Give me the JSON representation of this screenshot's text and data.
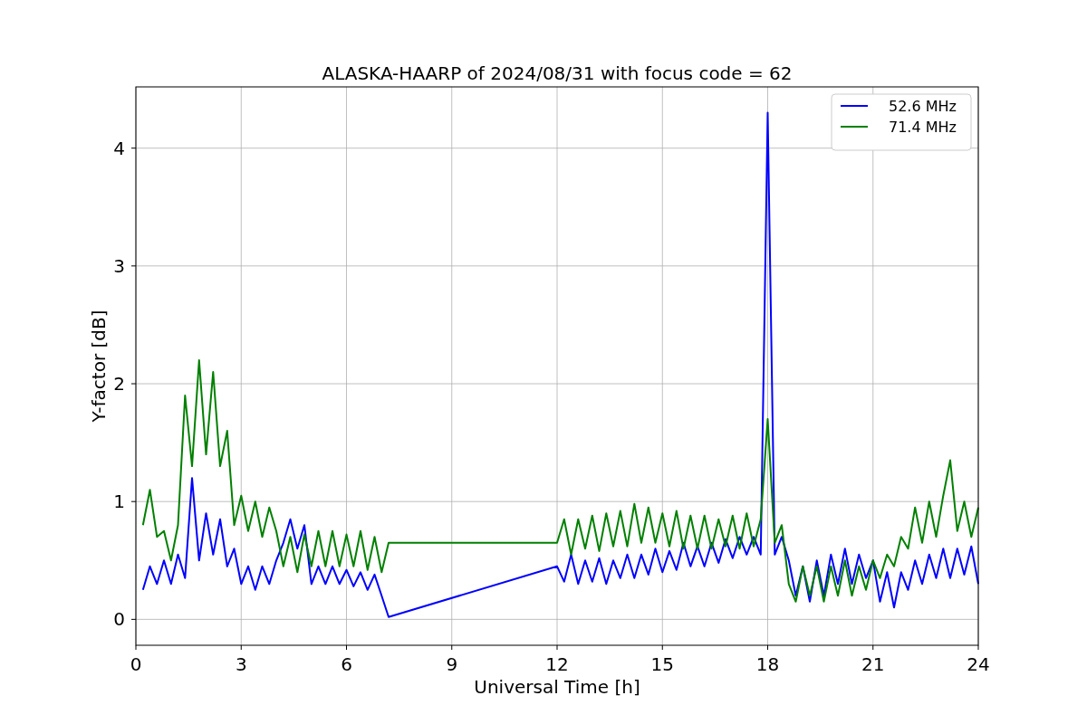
{
  "figure": {
    "chart_data": {
      "type": "line",
      "title": "ALASKA-HAARP of 2024/08/31 with focus code = 62",
      "xlabel": "Universal Time [h]",
      "ylabel": "Y-factor [dB]",
      "xlim": [
        0,
        24
      ],
      "ylim": [
        -0.22,
        4.52
      ],
      "xticks": [
        0,
        3,
        6,
        9,
        12,
        15,
        18,
        21,
        24
      ],
      "yticks": [
        0,
        1,
        2,
        3,
        4
      ],
      "grid": true,
      "legend": true,
      "x": [
        0.2,
        0.4,
        0.6,
        0.8,
        1.0,
        1.2,
        1.4,
        1.6,
        1.8,
        2.0,
        2.2,
        2.4,
        2.6,
        2.8,
        3.0,
        3.2,
        3.4,
        3.6,
        3.8,
        4.0,
        4.2,
        4.4,
        4.6,
        4.8,
        5.0,
        5.2,
        5.4,
        5.6,
        5.8,
        6.0,
        6.2,
        6.4,
        6.6,
        6.8,
        7.0,
        7.2,
        12.0,
        12.2,
        12.4,
        12.6,
        12.8,
        13.0,
        13.2,
        13.4,
        13.6,
        13.8,
        14.0,
        14.2,
        14.4,
        14.6,
        14.8,
        15.0,
        15.2,
        15.4,
        15.6,
        15.8,
        16.0,
        16.2,
        16.4,
        16.6,
        16.8,
        17.0,
        17.2,
        17.4,
        17.6,
        17.8,
        18.0,
        18.2,
        18.4,
        18.6,
        18.8,
        19.0,
        19.2,
        19.4,
        19.6,
        19.8,
        20.0,
        20.2,
        20.4,
        20.6,
        20.8,
        21.0,
        21.2,
        21.4,
        21.6,
        21.8,
        22.0,
        22.2,
        22.4,
        22.6,
        22.8,
        23.0,
        23.2,
        23.4,
        23.6,
        23.8,
        24.0
      ],
      "series": [
        {
          "name": "52.6 MHz",
          "color": "#0000ff",
          "values": [
            0.25,
            0.45,
            0.3,
            0.5,
            0.3,
            0.55,
            0.35,
            1.2,
            0.5,
            0.9,
            0.55,
            0.85,
            0.45,
            0.6,
            0.3,
            0.45,
            0.25,
            0.45,
            0.3,
            0.5,
            0.65,
            0.85,
            0.6,
            0.8,
            0.3,
            0.45,
            0.3,
            0.45,
            0.3,
            0.42,
            0.28,
            0.4,
            0.25,
            0.38,
            0.2,
            0.02,
            0.45,
            0.32,
            0.55,
            0.3,
            0.5,
            0.32,
            0.52,
            0.3,
            0.5,
            0.35,
            0.55,
            0.35,
            0.55,
            0.38,
            0.6,
            0.4,
            0.58,
            0.42,
            0.65,
            0.45,
            0.62,
            0.45,
            0.65,
            0.48,
            0.68,
            0.52,
            0.7,
            0.55,
            0.7,
            0.55,
            4.3,
            0.55,
            0.7,
            0.5,
            0.2,
            0.45,
            0.15,
            0.5,
            0.2,
            0.55,
            0.3,
            0.6,
            0.3,
            0.55,
            0.35,
            0.5,
            0.15,
            0.4,
            0.1,
            0.4,
            0.25,
            0.5,
            0.3,
            0.55,
            0.35,
            0.6,
            0.35,
            0.6,
            0.38,
            0.62,
            0.3
          ]
        },
        {
          "name": "71.4 MHz",
          "color": "#008000",
          "values": [
            0.8,
            1.1,
            0.7,
            0.75,
            0.5,
            0.8,
            1.9,
            1.3,
            2.2,
            1.4,
            2.1,
            1.3,
            1.6,
            0.8,
            1.05,
            0.75,
            1.0,
            0.7,
            0.95,
            0.75,
            0.45,
            0.7,
            0.4,
            0.72,
            0.45,
            0.75,
            0.45,
            0.75,
            0.45,
            0.72,
            0.45,
            0.75,
            0.42,
            0.7,
            0.4,
            0.65,
            0.65,
            0.85,
            0.55,
            0.85,
            0.6,
            0.88,
            0.58,
            0.9,
            0.62,
            0.92,
            0.62,
            0.98,
            0.65,
            0.95,
            0.65,
            0.9,
            0.62,
            0.92,
            0.6,
            0.88,
            0.6,
            0.88,
            0.6,
            0.85,
            0.62,
            0.88,
            0.6,
            0.9,
            0.62,
            0.85,
            1.7,
            0.65,
            0.8,
            0.3,
            0.15,
            0.45,
            0.2,
            0.45,
            0.15,
            0.45,
            0.2,
            0.5,
            0.2,
            0.45,
            0.25,
            0.5,
            0.35,
            0.55,
            0.45,
            0.7,
            0.6,
            0.95,
            0.65,
            1.0,
            0.7,
            1.05,
            1.35,
            0.75,
            1.0,
            0.7,
            0.95
          ]
        }
      ]
    }
  }
}
